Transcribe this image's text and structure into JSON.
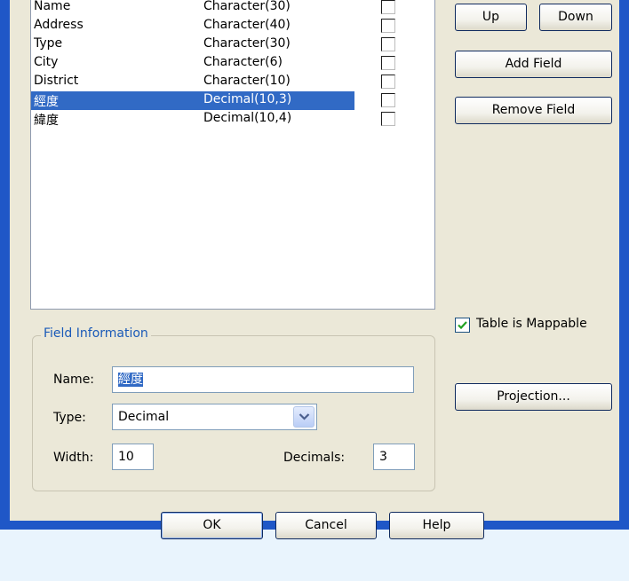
{
  "field_list": {
    "rows": [
      {
        "name": "Name",
        "type": "Character(30)",
        "indexed": false
      },
      {
        "name": "Address",
        "type": "Character(40)",
        "indexed": false
      },
      {
        "name": "Type",
        "type": "Character(30)",
        "indexed": false
      },
      {
        "name": "City",
        "type": "Character(6)",
        "indexed": false
      },
      {
        "name": "District",
        "type": "Character(10)",
        "indexed": false
      },
      {
        "name": "經度",
        "type": "Decimal(10,3)",
        "indexed": false
      },
      {
        "name": "緯度",
        "type": "Decimal(10,4)",
        "indexed": false
      }
    ],
    "selected_index": 5
  },
  "buttons": {
    "up": "Up",
    "down": "Down",
    "add_field": "Add Field",
    "remove_field": "Remove Field",
    "projection": "Projection...",
    "ok": "OK",
    "cancel": "Cancel",
    "help": "Help"
  },
  "field_info": {
    "title": "Field Information",
    "name_label": "Name:",
    "name_value": "經度",
    "type_label": "Type:",
    "type_value": "Decimal",
    "width_label": "Width:",
    "width_value": "10",
    "decimals_label": "Decimals:",
    "decimals_value": "3"
  },
  "mappable": {
    "label": "Table is Mappable",
    "checked": true
  },
  "colors": {
    "selection": "#316ac5",
    "frame": "#1f57c7",
    "group_title": "#1a5ab8",
    "dialog_bg": "#ebe8d8"
  }
}
